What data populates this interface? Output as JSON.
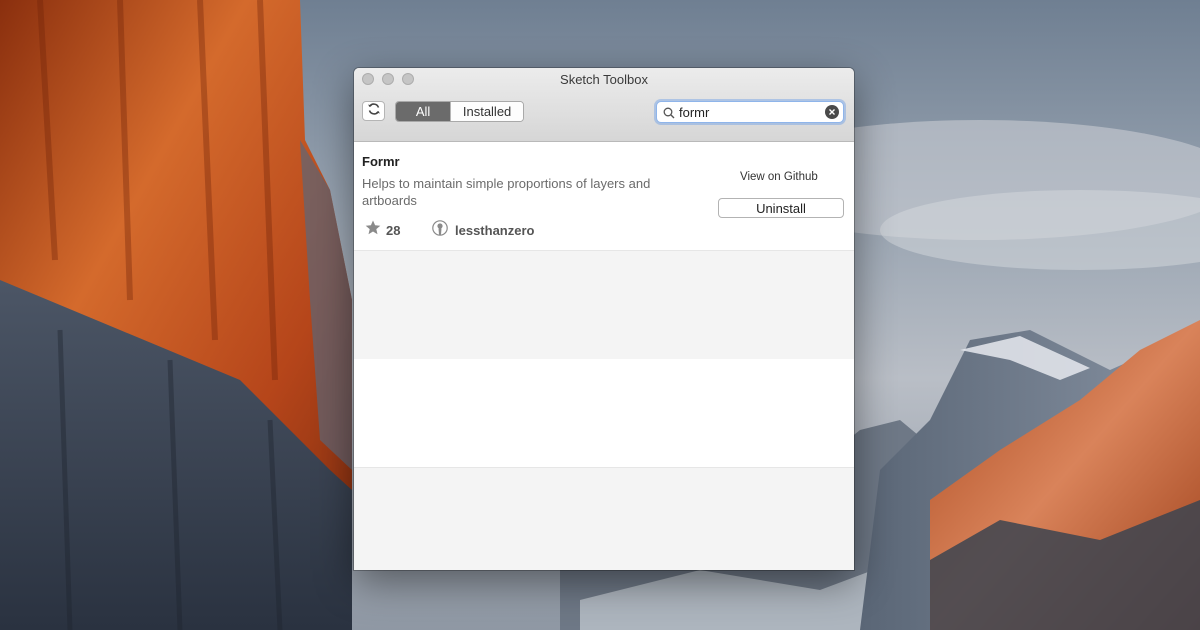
{
  "window": {
    "title": "Sketch Toolbox"
  },
  "toolbar": {
    "refresh_icon": "refresh-icon",
    "tabs": [
      {
        "label": "All",
        "selected": true
      },
      {
        "label": "Installed",
        "selected": false
      }
    ],
    "search": {
      "value": "formr",
      "placeholder": ""
    }
  },
  "plugins": [
    {
      "name": "Formr",
      "description": "Helps to maintain simple proportions of layers and artboards",
      "stars": "28",
      "author": "lessthanzero",
      "github_label": "View on Github",
      "action_label": "Uninstall"
    }
  ],
  "colors": {
    "selected_tab": "#6b6b6b",
    "search_focus": "#8fb5ea"
  }
}
